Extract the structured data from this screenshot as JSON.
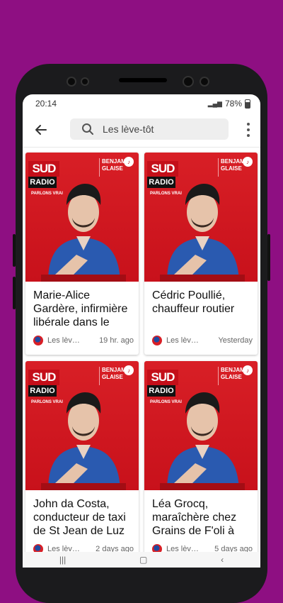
{
  "status": {
    "time": "20:14",
    "battery": "78%"
  },
  "toolbar": {
    "search_text": "Les lève-tôt",
    "back_icon": "arrow-left-icon",
    "search_icon": "search-icon",
    "more_icon": "more-vert-icon"
  },
  "thumbnail": {
    "logo_top": "SUD",
    "logo_bottom": "RADIO",
    "tagline": "PARLONS VRAI",
    "host_line1": "BENJAMIN",
    "host_line2": "GLAISE"
  },
  "episodes": [
    {
      "title": "Marie-Alice Gardère, infirmière libérale dans le",
      "source": "Les lève-tôt",
      "time": "19 hr. ago"
    },
    {
      "title": "Cédric Poullié, chauffeur routier",
      "source": "Les lève-tôt",
      "time": "Yesterday"
    },
    {
      "title": "John da Costa, conducteur de taxi de St Jean de Luz",
      "source": "Les lève-tôt",
      "time": "2 days ago"
    },
    {
      "title": "Léa Grocq, maraîchère chez Grains de F'oli à",
      "source": "Les lève-tôt",
      "time": "5 days ago"
    }
  ],
  "colors": {
    "background": "#8e0f82",
    "brand_red": "#d81f26"
  }
}
